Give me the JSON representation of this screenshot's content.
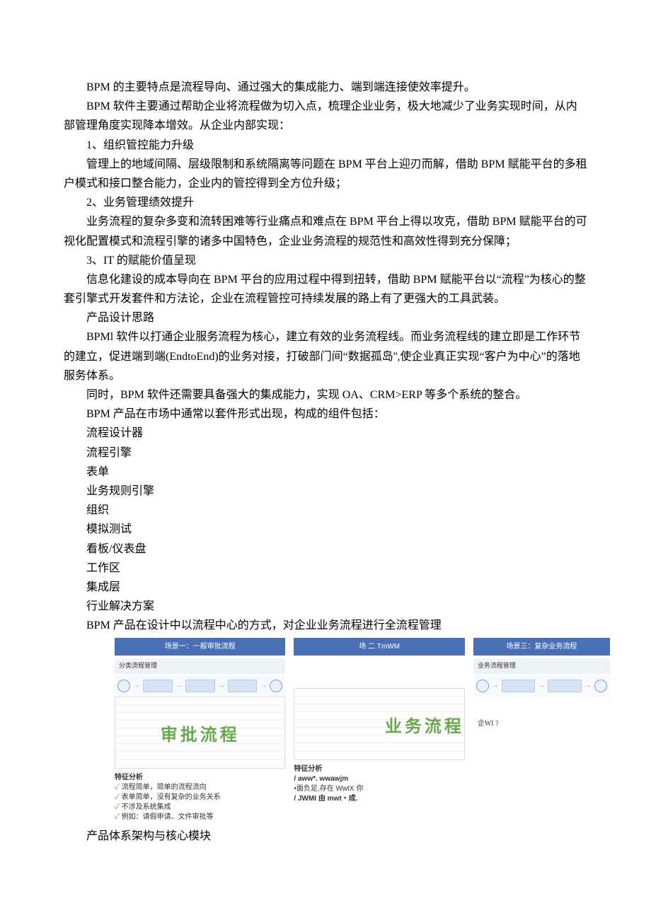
{
  "paragraphs": {
    "p1": "BPM 的主要特点是流程导向、通过强大的集成能力、端到端连接使效率提升。",
    "p2": "BPM 软件主要通过帮助企业将流程做为切入点，梳理企业业务，极大地减少了业务实现时间，从内部管理角度实现降本增效。从企业内部实现：",
    "l1": "1、组织管控能力升级",
    "p3": "管理上的地域间隔、层级限制和系统隔离等问题在 BPM 平台上迎刃而解，借助 BPM 赋能平台的多租户模式和接口整合能力，企业内的管控得到全方位升级；",
    "l2": "2、业务管理绩效提升",
    "p4": "业务流程的复杂多变和流转困难等行业痛点和难点在 BPM 平台上得以攻克，借助 BPM 赋能平台的可视化配置模式和流程引擎的诸多中国特色，企业业务流程的规范性和高效性得到充分保障；",
    "l3": "3、IT 的赋能价值呈现",
    "p5": "信息化建设的成本导向在 BPM 平台的应用过程中得到扭转，借助 BPM 赋能平台以“流程”为核心的整套引擎式开发套件和方法论，企业在流程管控可持续发展的路上有了更强大的工具武装。",
    "h_design": "产品设计思路",
    "p6": "BPMl 软件以打通企业服务流程为核心，建立有效的业务流程线。而业务流程线的建立即是工作环节的建立，促进端到端(EndtoEnd)的业务对接，打破部门间“数据孤岛'',使企业真正实现“客户为中心”的落地服务体系。",
    "p7": "同时，BPM 软件还需要具备强大的集成能力，实现 OA、CRM>ERP 等多个系统的整合。",
    "p8": "BPM 产品在市场中通常以套件形式出现，构成的组件包括：",
    "c1": "流程设计器",
    "c2": "流程引擎",
    "c3": "表单",
    "c4": "业务规则引擎",
    "c5": "组织",
    "c6": "模拟测试",
    "c7": "看板/仪表盘",
    "c8": "工作区",
    "c9": "集成层",
    "c10": "行业解决方案",
    "p9": "BPM 产品在设计中以流程中心的方式，对企业业务流程进行全流程管理",
    "p_last": "产品体系架构与核心模块"
  },
  "figure": {
    "scene1": {
      "title": "场景一：一般审批流程",
      "subbar": "分类流程管理",
      "big": "审批流程",
      "analysis_title": "特征分析",
      "a1": "流程简单，简单的流程流向",
      "a2": "表单简单，没有复杂的业务关系",
      "a3": "不涉及系统集成",
      "a4": "例如：请假申请、文件审批等"
    },
    "scene2": {
      "title": "场 二 TmWM",
      "big": "业务流程",
      "analysis_title": "特征分析",
      "a1": "/ aww*. wwawjm",
      "a2": "•面负足,存在 WwtX 你",
      "a3": "/ JWMI 由 mwt・成."
    },
    "scene3": {
      "title": "场景三：复杂业务流程",
      "subbar": "业务流程管理",
      "body_line": "企WI          ?"
    }
  }
}
